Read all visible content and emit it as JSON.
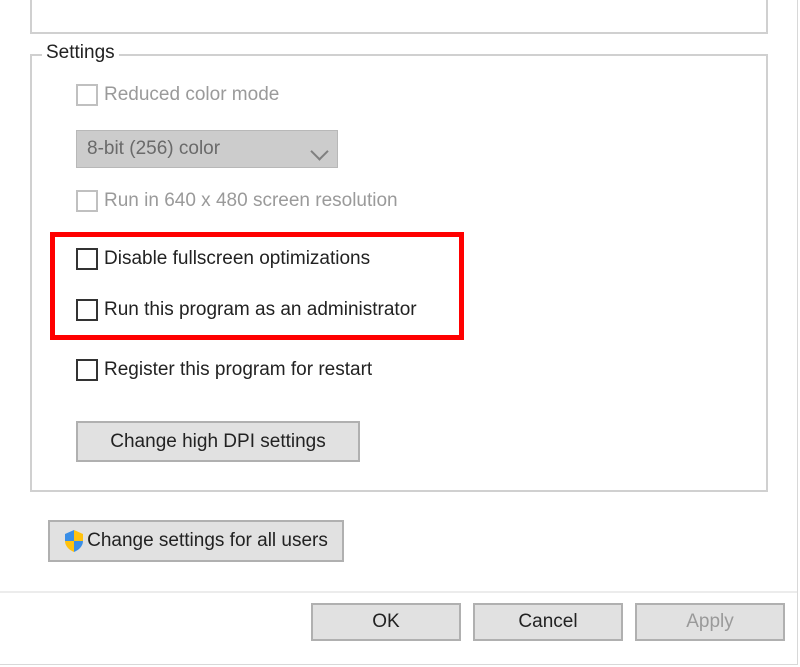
{
  "fieldset": {
    "legend": "Settings"
  },
  "options": {
    "reduced_color_mode": "Reduced color mode",
    "color_depth": "8-bit (256) color",
    "low_res": "Run in 640 x 480 screen resolution",
    "disable_fullscreen": "Disable fullscreen optimizations",
    "run_as_admin": "Run this program as an administrator",
    "register_restart": "Register this program for restart",
    "change_dpi": "Change high DPI settings",
    "change_all_users": "Change settings for all users"
  },
  "buttons": {
    "ok": "OK",
    "cancel": "Cancel",
    "apply": "Apply"
  },
  "icons": {
    "shield": "shield-icon",
    "dropdown_chevron": "chevron-down-icon"
  }
}
